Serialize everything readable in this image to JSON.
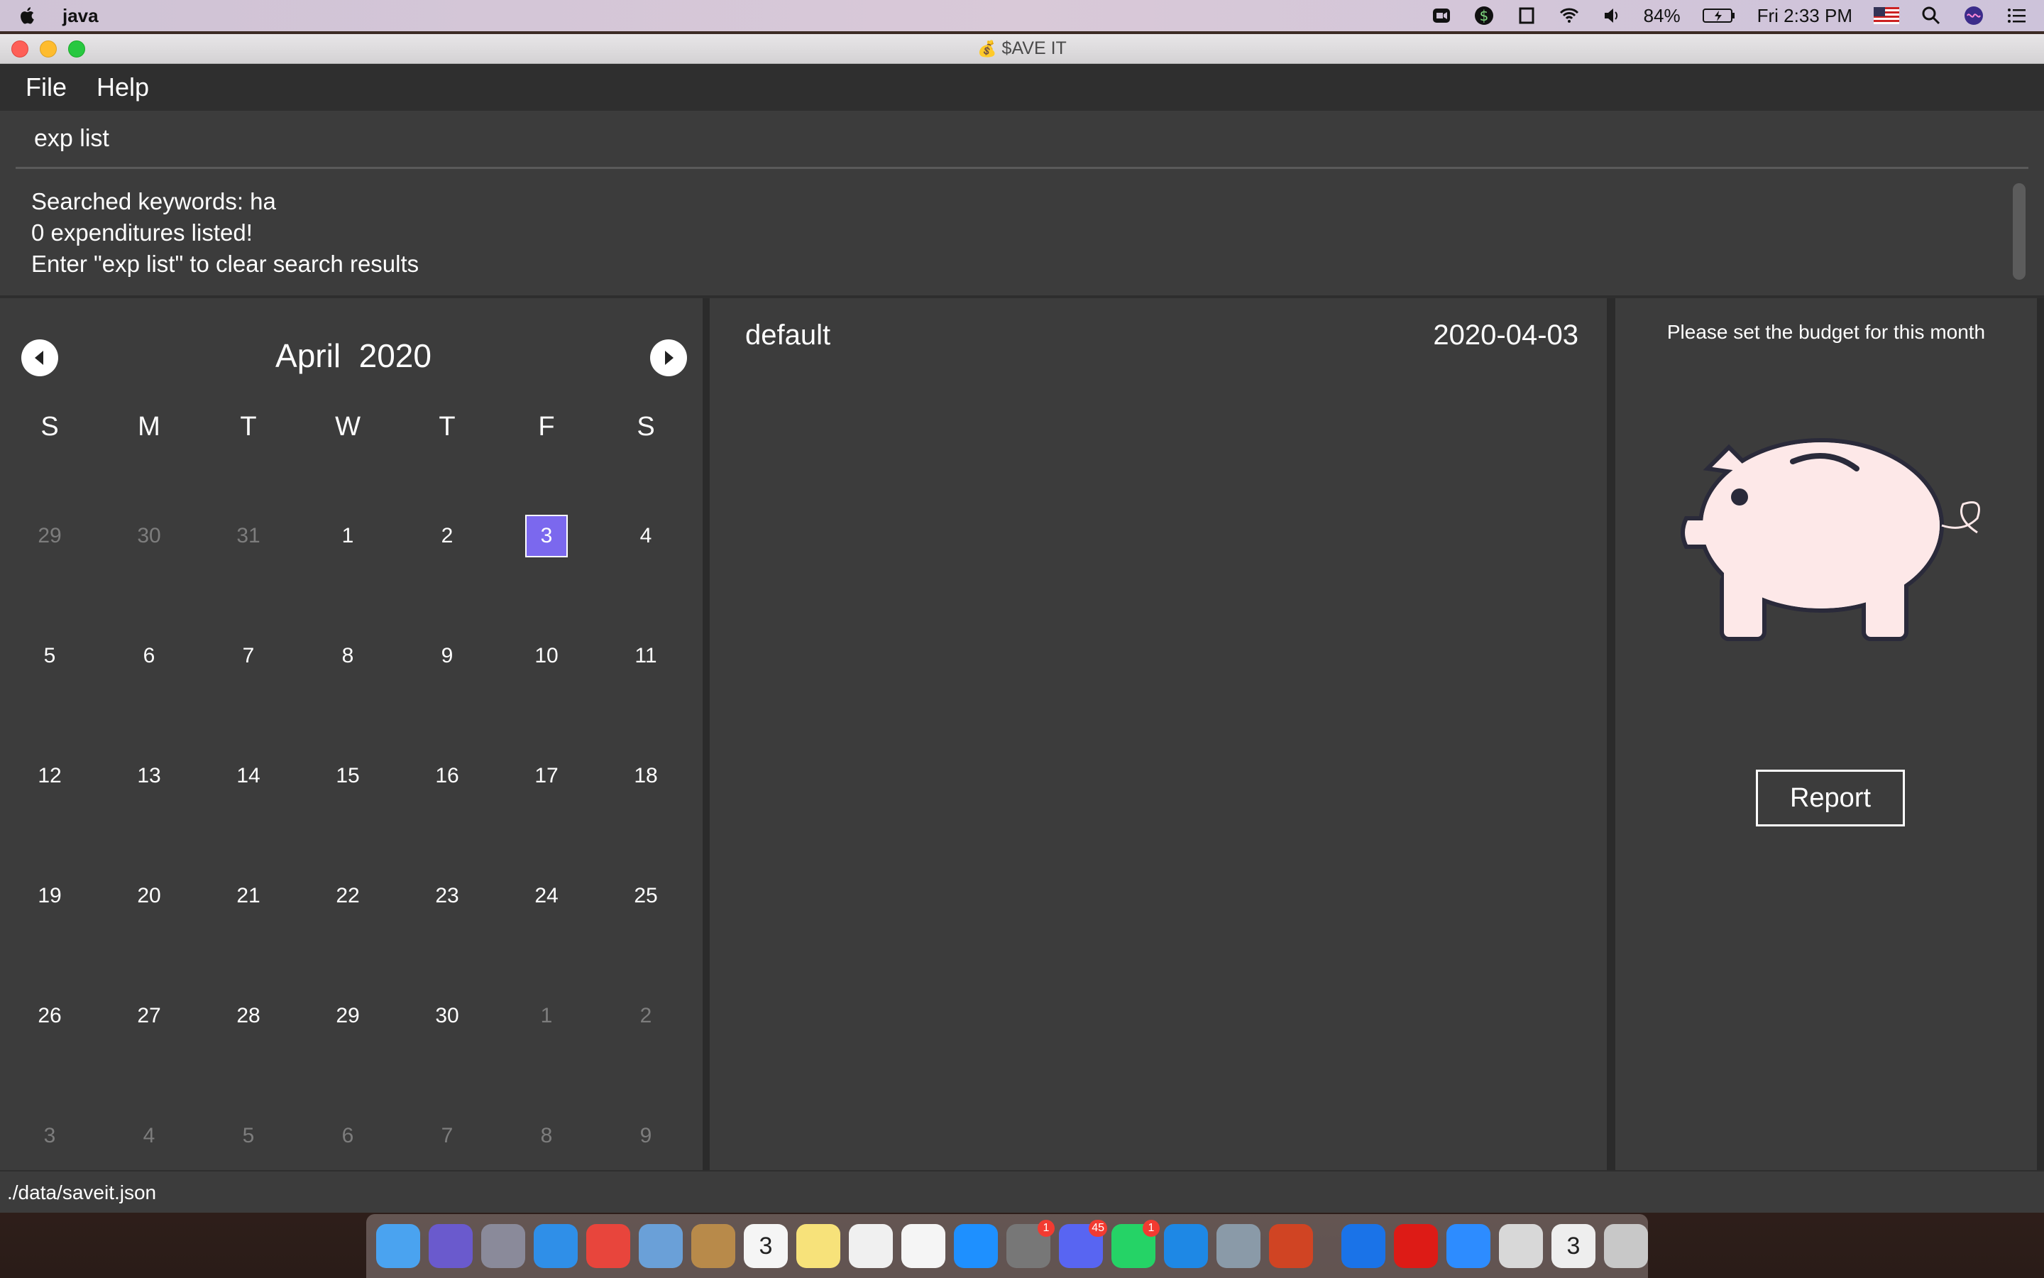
{
  "menubar": {
    "app_name": "java",
    "battery": "84%",
    "clock": "Fri 2:33 PM"
  },
  "window": {
    "title": "$AVE IT"
  },
  "menu": {
    "file": "File",
    "help": "Help"
  },
  "command": {
    "value": "exp list"
  },
  "result": {
    "line1": "Searched keywords: ha",
    "line2": "0 expenditures listed!",
    "line3": "Enter \"exp list\" to clear search results"
  },
  "calendar": {
    "month_label": "April",
    "year_label": "2020",
    "weekdays": [
      "S",
      "M",
      "T",
      "W",
      "T",
      "F",
      "S"
    ],
    "weeks": [
      [
        {
          "d": "29",
          "m": true
        },
        {
          "d": "30",
          "m": true
        },
        {
          "d": "31",
          "m": true
        },
        {
          "d": "1"
        },
        {
          "d": "2"
        },
        {
          "d": "3",
          "sel": true
        },
        {
          "d": "4"
        }
      ],
      [
        {
          "d": "5"
        },
        {
          "d": "6"
        },
        {
          "d": "7"
        },
        {
          "d": "8"
        },
        {
          "d": "9"
        },
        {
          "d": "10"
        },
        {
          "d": "11"
        }
      ],
      [
        {
          "d": "12"
        },
        {
          "d": "13"
        },
        {
          "d": "14"
        },
        {
          "d": "15"
        },
        {
          "d": "16"
        },
        {
          "d": "17"
        },
        {
          "d": "18"
        }
      ],
      [
        {
          "d": "19"
        },
        {
          "d": "20"
        },
        {
          "d": "21"
        },
        {
          "d": "22"
        },
        {
          "d": "23"
        },
        {
          "d": "24"
        },
        {
          "d": "25"
        }
      ],
      [
        {
          "d": "26"
        },
        {
          "d": "27"
        },
        {
          "d": "28"
        },
        {
          "d": "29"
        },
        {
          "d": "30"
        },
        {
          "d": "1",
          "m": true
        },
        {
          "d": "2",
          "m": true
        }
      ],
      [
        {
          "d": "3",
          "m": true
        },
        {
          "d": "4",
          "m": true
        },
        {
          "d": "5",
          "m": true
        },
        {
          "d": "6",
          "m": true
        },
        {
          "d": "7",
          "m": true
        },
        {
          "d": "8",
          "m": true
        },
        {
          "d": "9",
          "m": true
        }
      ]
    ],
    "selected_color": "#7b68ee"
  },
  "expenses": {
    "tag": "default",
    "date": "2020-04-03"
  },
  "budget": {
    "message": "Please set the budget for this month",
    "report_label": "Report",
    "piggy_color": "#fde8e8"
  },
  "status": {
    "path": "./data/saveit.json"
  },
  "dock": {
    "items": [
      {
        "name": "finder-icon",
        "color": "#4aa3f0"
      },
      {
        "name": "siri-icon",
        "color": "#6a5acd"
      },
      {
        "name": "launchpad-icon",
        "color": "#8a8a9a"
      },
      {
        "name": "safari-icon",
        "color": "#2f8fe8"
      },
      {
        "name": "chrome-icon",
        "color": "#e8453c"
      },
      {
        "name": "preview-icon",
        "color": "#6aa0d8"
      },
      {
        "name": "contacts-icon",
        "color": "#b88a4a"
      },
      {
        "name": "calendar-icon",
        "color": "#f5f5f5",
        "label": "3"
      },
      {
        "name": "notes-icon",
        "color": "#f7e27a"
      },
      {
        "name": "reminders-icon",
        "color": "#f0f0f0"
      },
      {
        "name": "music-icon",
        "color": "#f5f5f5"
      },
      {
        "name": "app-store-icon",
        "color": "#1e90ff"
      },
      {
        "name": "system-preferences-icon",
        "color": "#777777",
        "badge": "1"
      },
      {
        "name": "discord-icon",
        "color": "#5865f2",
        "badge": "45"
      },
      {
        "name": "whatsapp-icon",
        "color": "#25d366",
        "badge": "1"
      },
      {
        "name": "vscode-icon",
        "color": "#1e88e5"
      },
      {
        "name": "virtualbox-icon",
        "color": "#8a9aa8"
      },
      {
        "name": "powerpoint-icon",
        "color": "#d04423"
      },
      {
        "name": "maps-pin-icon",
        "color": "#1a73e8"
      },
      {
        "name": "angular-icon",
        "color": "#dd1b16"
      },
      {
        "name": "zoom-icon",
        "color": "#2d8cff"
      },
      {
        "name": "java-cup-icon",
        "color": "#d8d8d8"
      },
      {
        "name": "calendar-doc-icon",
        "color": "#eeeeee",
        "label": "3"
      },
      {
        "name": "trash-icon",
        "color": "#c8c8c8"
      }
    ]
  }
}
